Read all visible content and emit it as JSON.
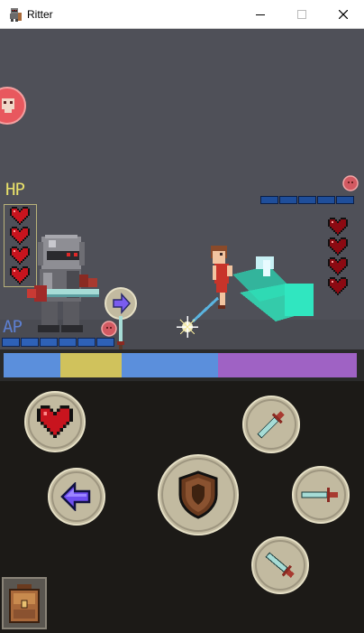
{
  "window": {
    "title": "Ritter",
    "app_icon": "knight-icon",
    "controls": [
      "minimize-icon",
      "maximize-icon",
      "close-icon"
    ]
  },
  "hud": {
    "hp_label": "HP",
    "ap_label": "AP",
    "player_hearts": 4,
    "enemy_hearts": 4,
    "player_ap_cells": 6,
    "enemy_bar_cells": 5
  },
  "timeline": {
    "segments": [
      {
        "color": "#5b8fdc"
      },
      {
        "color": "#d0c25c"
      },
      {
        "color": "#5b8fdc"
      },
      {
        "color": "#9f62c4"
      }
    ]
  },
  "controls": {
    "buttons": [
      {
        "name": "heal-button",
        "icon": "heart-icon"
      },
      {
        "name": "retreat-button",
        "icon": "arrow-left-icon"
      },
      {
        "name": "defend-button",
        "icon": "shield-icon"
      },
      {
        "name": "attack-high-button",
        "icon": "sword-icon"
      },
      {
        "name": "attack-mid-button",
        "icon": "sword-icon"
      },
      {
        "name": "attack-low-button",
        "icon": "sword-icon"
      }
    ],
    "inventory_icon": "backpack-icon"
  },
  "colors": {
    "game_bg": "#4f5058",
    "controls_bg": "#1c1a17",
    "hp_label": "#e8e06a",
    "ap_label": "#5d7fd0",
    "heart_red": "#c8141e",
    "enemy_heart": "#8c0a12",
    "button_fill": "#c2baa0"
  }
}
